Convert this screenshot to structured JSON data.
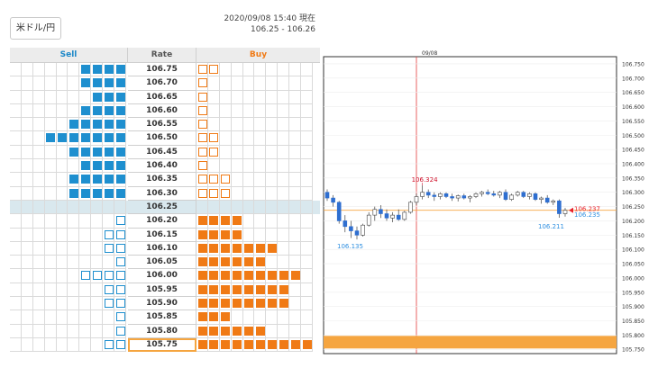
{
  "header": {
    "pair_button": "米ドル/円",
    "timestamp": "2020/09/08 15:40 現在",
    "bid_ask": "106.25 - 106.26"
  },
  "order_book": {
    "headers": {
      "sell": "Sell",
      "rate": "Rate",
      "buy": "Buy"
    },
    "rows": [
      {
        "rate": "106.75",
        "sell_filled": 4,
        "sell_outline": 0,
        "buy_filled": 0,
        "buy_outline": 2
      },
      {
        "rate": "106.70",
        "sell_filled": 4,
        "sell_outline": 0,
        "buy_filled": 0,
        "buy_outline": 1
      },
      {
        "rate": "106.65",
        "sell_filled": 3,
        "sell_outline": 0,
        "buy_filled": 0,
        "buy_outline": 1
      },
      {
        "rate": "106.60",
        "sell_filled": 4,
        "sell_outline": 0,
        "buy_filled": 0,
        "buy_outline": 1
      },
      {
        "rate": "106.55",
        "sell_filled": 5,
        "sell_outline": 0,
        "buy_filled": 0,
        "buy_outline": 1
      },
      {
        "rate": "106.50",
        "sell_filled": 7,
        "sell_outline": 0,
        "buy_filled": 0,
        "buy_outline": 2
      },
      {
        "rate": "106.45",
        "sell_filled": 5,
        "sell_outline": 0,
        "buy_filled": 0,
        "buy_outline": 2
      },
      {
        "rate": "106.40",
        "sell_filled": 4,
        "sell_outline": 0,
        "buy_filled": 0,
        "buy_outline": 1
      },
      {
        "rate": "106.35",
        "sell_filled": 5,
        "sell_outline": 0,
        "buy_filled": 0,
        "buy_outline": 3
      },
      {
        "rate": "106.30",
        "sell_filled": 5,
        "sell_outline": 0,
        "buy_filled": 0,
        "buy_outline": 3
      },
      {
        "rate": "106.25",
        "sell_filled": 0,
        "sell_outline": 0,
        "buy_filled": 0,
        "buy_outline": 0
      },
      {
        "rate": "106.20",
        "sell_filled": 0,
        "sell_outline": 1,
        "buy_filled": 4,
        "buy_outline": 0
      },
      {
        "rate": "106.15",
        "sell_filled": 0,
        "sell_outline": 2,
        "buy_filled": 4,
        "buy_outline": 0
      },
      {
        "rate": "106.10",
        "sell_filled": 0,
        "sell_outline": 2,
        "buy_filled": 7,
        "buy_outline": 0
      },
      {
        "rate": "106.05",
        "sell_filled": 0,
        "sell_outline": 1,
        "buy_filled": 6,
        "buy_outline": 0
      },
      {
        "rate": "106.00",
        "sell_filled": 0,
        "sell_outline": 4,
        "buy_filled": 9,
        "buy_outline": 0
      },
      {
        "rate": "105.95",
        "sell_filled": 0,
        "sell_outline": 2,
        "buy_filled": 8,
        "buy_outline": 0
      },
      {
        "rate": "105.90",
        "sell_filled": 0,
        "sell_outline": 2,
        "buy_filled": 8,
        "buy_outline": 0
      },
      {
        "rate": "105.85",
        "sell_filled": 0,
        "sell_outline": 1,
        "buy_filled": 3,
        "buy_outline": 0
      },
      {
        "rate": "105.80",
        "sell_filled": 0,
        "sell_outline": 1,
        "buy_filled": 6,
        "buy_outline": 0
      },
      {
        "rate": "105.75",
        "sell_filled": 0,
        "sell_outline": 2,
        "buy_filled": 10,
        "buy_outline": 0
      }
    ],
    "current_rate": "106.25",
    "selected_rate": "105.75"
  },
  "chart_data": {
    "type": "candlestick",
    "date_label": "09/08",
    "y_ticks": [
      "106.750",
      "106.700",
      "106.650",
      "106.600",
      "106.550",
      "106.500",
      "106.450",
      "106.400",
      "106.350",
      "106.300",
      "106.250",
      "106.200",
      "106.150",
      "106.100",
      "106.050",
      "106.000",
      "105.950",
      "105.900",
      "105.850",
      "105.800",
      "105.750"
    ],
    "ylim": [
      105.735,
      106.775
    ],
    "high_label": "106.324",
    "low_label": "106.135",
    "last_low_label": "106.211",
    "ask_label": "106.237",
    "bid_label": "106.235",
    "reference_level": 106.237,
    "highlight_level": 105.775,
    "candles": [
      {
        "o": 106.3,
        "h": 106.31,
        "l": 106.27,
        "c": 106.28
      },
      {
        "o": 106.28,
        "h": 106.29,
        "l": 106.25,
        "c": 106.265
      },
      {
        "o": 106.265,
        "h": 106.27,
        "l": 106.19,
        "c": 106.2
      },
      {
        "o": 106.2,
        "h": 106.22,
        "l": 106.16,
        "c": 106.18
      },
      {
        "o": 106.18,
        "h": 106.2,
        "l": 106.14,
        "c": 106.165
      },
      {
        "o": 106.165,
        "h": 106.18,
        "l": 106.135,
        "c": 106.15
      },
      {
        "o": 106.15,
        "h": 106.19,
        "l": 106.145,
        "c": 106.185
      },
      {
        "o": 106.185,
        "h": 106.23,
        "l": 106.18,
        "c": 106.22
      },
      {
        "o": 106.22,
        "h": 106.25,
        "l": 106.2,
        "c": 106.24
      },
      {
        "o": 106.24,
        "h": 106.255,
        "l": 106.21,
        "c": 106.225
      },
      {
        "o": 106.225,
        "h": 106.24,
        "l": 106.2,
        "c": 106.21
      },
      {
        "o": 106.21,
        "h": 106.23,
        "l": 106.195,
        "c": 106.22
      },
      {
        "o": 106.22,
        "h": 106.24,
        "l": 106.2,
        "c": 106.205
      },
      {
        "o": 106.205,
        "h": 106.235,
        "l": 106.2,
        "c": 106.23
      },
      {
        "o": 106.23,
        "h": 106.27,
        "l": 106.225,
        "c": 106.265
      },
      {
        "o": 106.265,
        "h": 106.295,
        "l": 106.255,
        "c": 106.285
      },
      {
        "o": 106.285,
        "h": 106.324,
        "l": 106.275,
        "c": 106.3
      },
      {
        "o": 106.3,
        "h": 106.31,
        "l": 106.28,
        "c": 106.29
      },
      {
        "o": 106.29,
        "h": 106.3,
        "l": 106.27,
        "c": 106.285
      },
      {
        "o": 106.285,
        "h": 106.3,
        "l": 106.275,
        "c": 106.295
      },
      {
        "o": 106.295,
        "h": 106.3,
        "l": 106.28,
        "c": 106.285
      },
      {
        "o": 106.285,
        "h": 106.295,
        "l": 106.27,
        "c": 106.28
      },
      {
        "o": 106.28,
        "h": 106.292,
        "l": 106.268,
        "c": 106.288
      },
      {
        "o": 106.288,
        "h": 106.295,
        "l": 106.275,
        "c": 106.28
      },
      {
        "o": 106.28,
        "h": 106.29,
        "l": 106.265,
        "c": 106.285
      },
      {
        "o": 106.285,
        "h": 106.3,
        "l": 106.28,
        "c": 106.295
      },
      {
        "o": 106.295,
        "h": 106.305,
        "l": 106.285,
        "c": 106.3
      },
      {
        "o": 106.3,
        "h": 106.31,
        "l": 106.29,
        "c": 106.295
      },
      {
        "o": 106.295,
        "h": 106.305,
        "l": 106.285,
        "c": 106.29
      },
      {
        "o": 106.29,
        "h": 106.305,
        "l": 106.28,
        "c": 106.3
      },
      {
        "o": 106.3,
        "h": 106.31,
        "l": 106.27,
        "c": 106.275
      },
      {
        "o": 106.275,
        "h": 106.295,
        "l": 106.27,
        "c": 106.29
      },
      {
        "o": 106.29,
        "h": 106.305,
        "l": 106.285,
        "c": 106.3
      },
      {
        "o": 106.3,
        "h": 106.305,
        "l": 106.28,
        "c": 106.285
      },
      {
        "o": 106.285,
        "h": 106.3,
        "l": 106.275,
        "c": 106.295
      },
      {
        "o": 106.295,
        "h": 106.3,
        "l": 106.27,
        "c": 106.275
      },
      {
        "o": 106.275,
        "h": 106.285,
        "l": 106.26,
        "c": 106.28
      },
      {
        "o": 106.28,
        "h": 106.29,
        "l": 106.26,
        "c": 106.265
      },
      {
        "o": 106.265,
        "h": 106.275,
        "l": 106.255,
        "c": 106.27
      },
      {
        "o": 106.27,
        "h": 106.275,
        "l": 106.211,
        "c": 106.225
      },
      {
        "o": 106.225,
        "h": 106.245,
        "l": 106.215,
        "c": 106.237
      }
    ],
    "colors": {
      "up": "#ffffff",
      "down": "#2f6fd0",
      "ask": "#e8202a",
      "bid": "#2f8fe0",
      "level": "#f5a540"
    }
  }
}
